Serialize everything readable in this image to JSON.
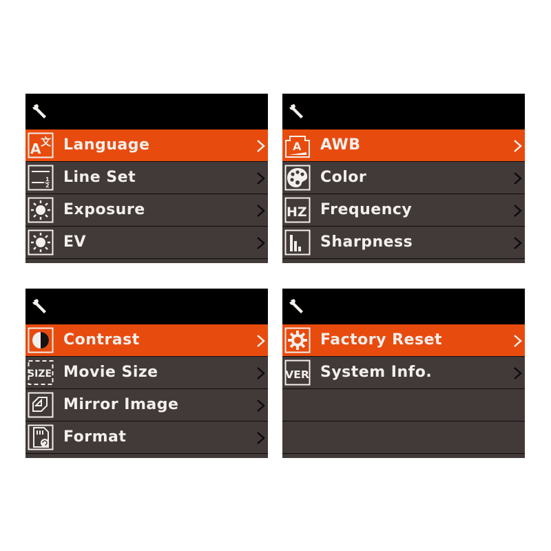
{
  "colors": {
    "selected": "#e84b0e",
    "row_bg": "#423a39",
    "header_bg": "#000000",
    "text": "#f2efec"
  },
  "panels": [
    {
      "header_icon": "wrench-icon",
      "items": [
        {
          "label": "Language",
          "icon": "language-icon",
          "selected": true
        },
        {
          "label": "Line Set",
          "icon": "line-set-icon",
          "selected": false
        },
        {
          "label": "Exposure",
          "icon": "sun-icon",
          "selected": false
        },
        {
          "label": "EV",
          "icon": "sun-icon",
          "selected": false
        }
      ]
    },
    {
      "header_icon": "wrench-icon",
      "items": [
        {
          "label": "AWB",
          "icon": "awb-icon",
          "selected": true
        },
        {
          "label": "Color",
          "icon": "palette-icon",
          "selected": false
        },
        {
          "label": "Frequency",
          "icon": "hz-icon",
          "selected": false
        },
        {
          "label": "Sharpness",
          "icon": "sharpness-icon",
          "selected": false
        }
      ]
    },
    {
      "header_icon": "wrench-icon",
      "items": [
        {
          "label": "Contrast",
          "icon": "contrast-icon",
          "selected": true
        },
        {
          "label": "Movie Size",
          "icon": "size-icon",
          "selected": false
        },
        {
          "label": "Mirror Image",
          "icon": "mirror-icon",
          "selected": false
        },
        {
          "label": "Format",
          "icon": "sd-card-icon",
          "selected": false
        }
      ]
    },
    {
      "header_icon": "wrench-icon",
      "items": [
        {
          "label": "Factory Reset",
          "icon": "factory-reset-icon",
          "selected": true
        },
        {
          "label": "System Info.",
          "icon": "version-icon",
          "selected": false
        }
      ]
    }
  ]
}
